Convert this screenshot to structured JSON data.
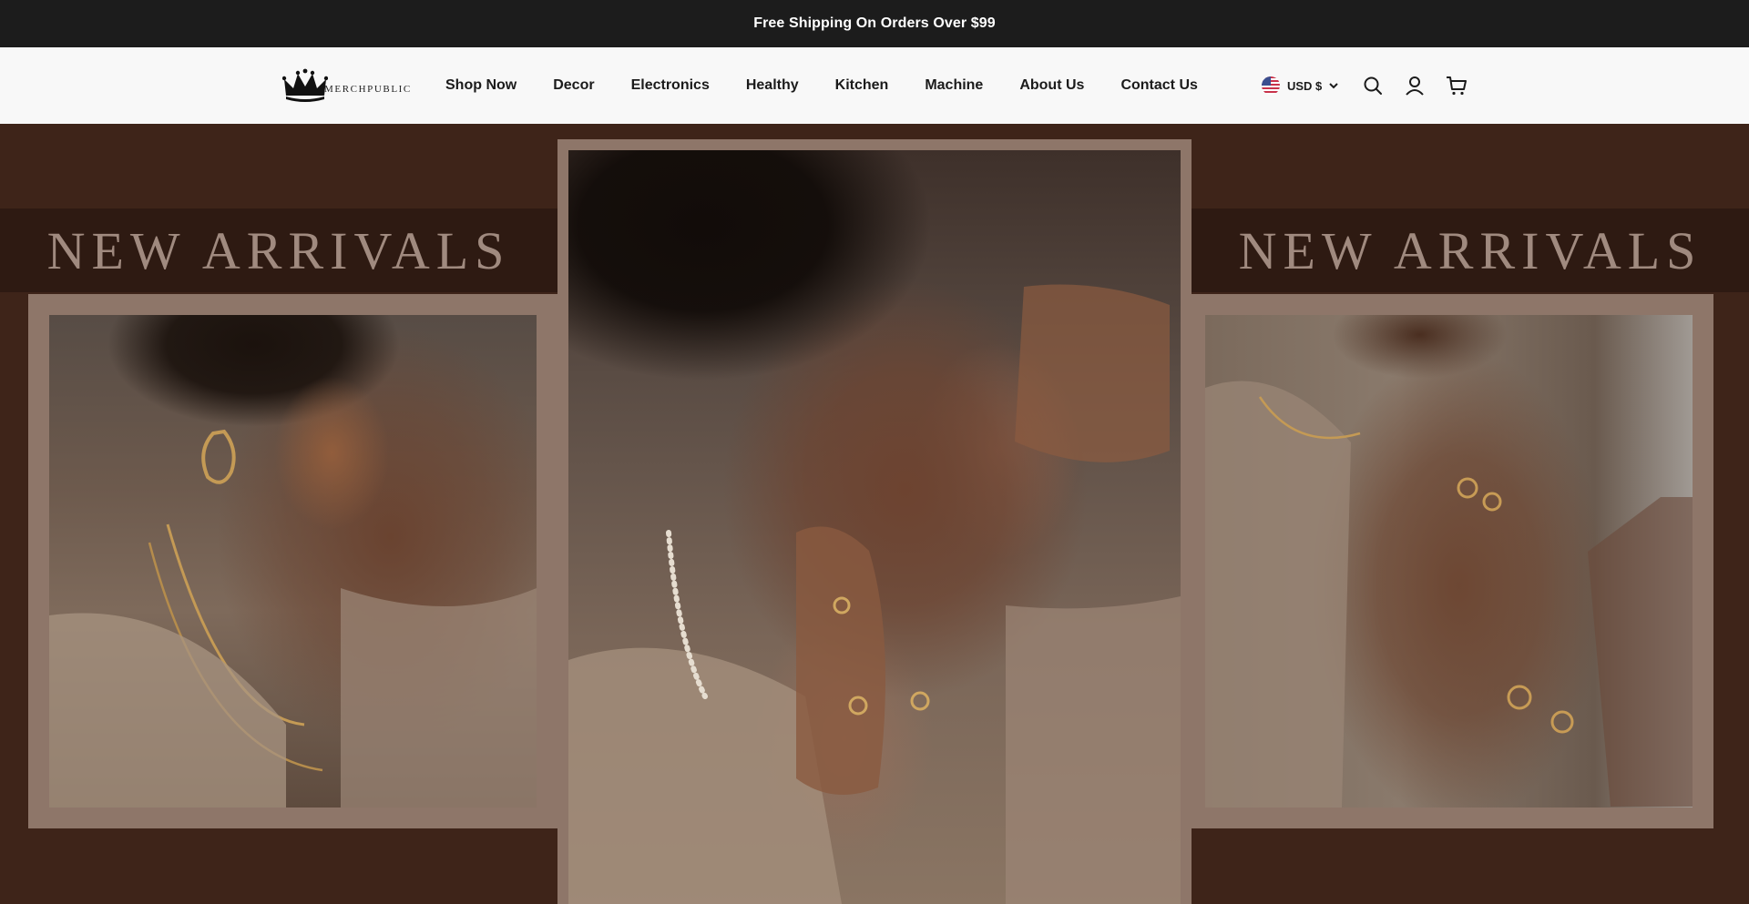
{
  "announcement": {
    "text": "Free Shipping On Orders Over $99"
  },
  "header": {
    "logo": {
      "text": "MERCHPUBLIC",
      "icon": "crown-icon"
    },
    "nav": [
      {
        "label": "Shop Now"
      },
      {
        "label": "Decor"
      },
      {
        "label": "Electronics"
      },
      {
        "label": "Healthy"
      },
      {
        "label": "Kitchen"
      },
      {
        "label": "Machine"
      },
      {
        "label": "About Us"
      },
      {
        "label": "Contact Us"
      }
    ],
    "currency": {
      "label": "USD $",
      "flag": "us-flag-icon"
    },
    "icons": {
      "search": "search-icon",
      "account": "account-icon",
      "cart": "cart-icon"
    }
  },
  "hero": {
    "left_banner": "NEW ARRIVALS",
    "right_banner": "NEW ARRIVALS"
  },
  "colors": {
    "announcement_bg": "#1c1c1c",
    "header_bg": "#f8f8f8",
    "hero_bg": "#3e2419",
    "frame": "#8e7669",
    "banner_text": "#a08a7f"
  }
}
